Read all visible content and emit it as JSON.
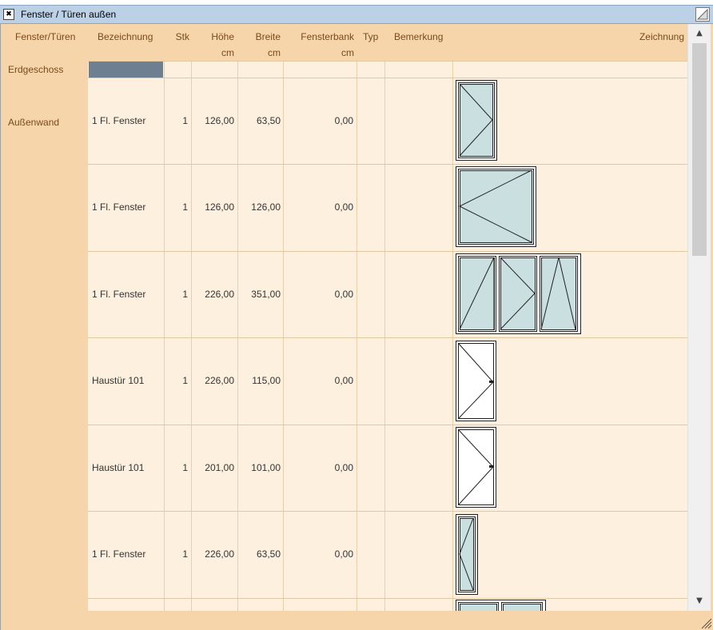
{
  "window": {
    "title": "Fenster / Türen außen",
    "toggle_icon": "collapse-icon"
  },
  "columns": [
    {
      "label": "Fenster/Türen",
      "unit": ""
    },
    {
      "label": "Bezeichnung",
      "unit": ""
    },
    {
      "label": "Stk",
      "unit": ""
    },
    {
      "label": "Höhe",
      "unit": "cm"
    },
    {
      "label": "Breite",
      "unit": "cm"
    },
    {
      "label": "Fensterbank",
      "unit": "cm"
    },
    {
      "label": "Typ",
      "unit": ""
    },
    {
      "label": "Bemerkung",
      "unit": ""
    },
    {
      "label": "Zeichnung",
      "unit": ""
    }
  ],
  "groups": {
    "floor": "Erdgeschoss",
    "wall": "Außenwand"
  },
  "rows": [
    {
      "name": "1 Fl. Fenster",
      "qty": "1",
      "height": "126,00",
      "width": "63,50",
      "sill": "0,00",
      "type": "",
      "note": "",
      "drawing": "window-single-icon"
    },
    {
      "name": "1 Fl. Fenster",
      "qty": "1",
      "height": "126,00",
      "width": "126,00",
      "sill": "0,00",
      "type": "",
      "note": "",
      "drawing": "window-wide-icon"
    },
    {
      "name": "1 Fl. Fenster",
      "qty": "1",
      "height": "226,00",
      "width": "351,00",
      "sill": "0,00",
      "type": "",
      "note": "",
      "drawing": "window-triple-icon"
    },
    {
      "name": "Haustür 101",
      "qty": "1",
      "height": "226,00",
      "width": "115,00",
      "sill": "0,00",
      "type": "",
      "note": "",
      "drawing": "door-icon"
    },
    {
      "name": "Haustür 101",
      "qty": "1",
      "height": "201,00",
      "width": "101,00",
      "sill": "0,00",
      "type": "",
      "note": "",
      "drawing": "door-icon"
    },
    {
      "name": "1 Fl. Fenster",
      "qty": "1",
      "height": "226,00",
      "width": "63,50",
      "sill": "0,00",
      "type": "",
      "note": "",
      "drawing": "window-narrow-icon"
    }
  ],
  "colors": {
    "glass": "#c9dfe0",
    "panel": "#f6d5aa",
    "cell": "#fef0df",
    "header_text": "#7a4a1a",
    "selection": "#6d7f90"
  }
}
